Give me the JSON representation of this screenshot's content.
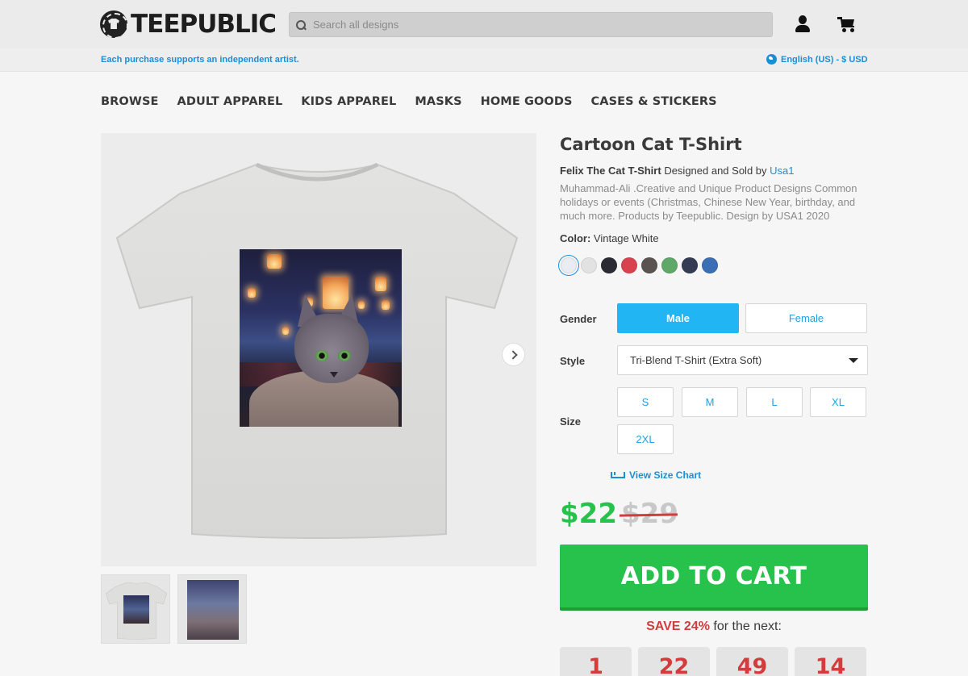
{
  "header": {
    "logo_text": "TEEPUBLIC",
    "search_placeholder": "Search all designs",
    "tagline": "Each purchase supports an independent artist.",
    "locale": "English (US) - $ USD"
  },
  "nav": {
    "items": [
      "BROWSE",
      "ADULT APPAREL",
      "KIDS APPAREL",
      "MASKS",
      "HOME GOODS",
      "CASES & STICKERS"
    ]
  },
  "product": {
    "title": "Cartoon Cat T-Shirt",
    "design_name": "Felix The Cat T-Shirt",
    "designed_by_text": "Designed and Sold by",
    "artist": "Usa1",
    "description": "Muhammad-Ali .Creative and Unique Product Designs Common holidays or events (Christmas, Chinese New Year, birthday, and much more. Products by Teepublic. Design by USA1 2020",
    "color_label": "Color:",
    "color_value": "Vintage White",
    "swatches": [
      {
        "name": "Vintage White",
        "color": "#e9ecf0",
        "selected": true
      },
      {
        "name": "Heather White",
        "color": "#e2e2e2",
        "selected": false
      },
      {
        "name": "Black",
        "color": "#2a2a33",
        "selected": false
      },
      {
        "name": "Red",
        "color": "#d8424f",
        "selected": false
      },
      {
        "name": "Brown",
        "color": "#5b5350",
        "selected": false
      },
      {
        "name": "Green",
        "color": "#5fa868",
        "selected": false
      },
      {
        "name": "Navy",
        "color": "#343b52",
        "selected": false
      },
      {
        "name": "Blue",
        "color": "#3a6fb5",
        "selected": false
      }
    ],
    "gender_label": "Gender",
    "gender_options": [
      "Male",
      "Female"
    ],
    "style_label": "Style",
    "style_value": "Tri-Blend T-Shirt (Extra Soft)",
    "size_label": "Size",
    "sizes": [
      "S",
      "M",
      "L",
      "XL",
      "2XL"
    ],
    "size_chart_label": "View Size Chart",
    "price": "$22",
    "old_price": "$29",
    "add_to_cart": "ADD TO CART",
    "save_pct": "SAVE 24%",
    "save_suffix": "for the next:",
    "countdown": [
      "1",
      "22",
      "49",
      "14"
    ]
  },
  "colors": {
    "accent_blue": "#22b5f3",
    "link_blue": "#1b8fd6",
    "cta_green": "#27c24c",
    "sale_red": "#d23c3c"
  }
}
